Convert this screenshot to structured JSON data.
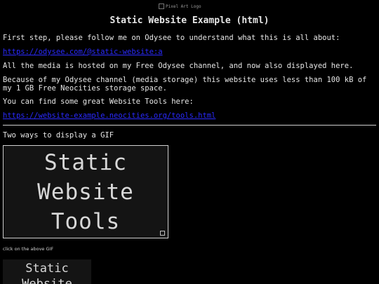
{
  "header_image": {
    "alt": "Pixel Art Logo"
  },
  "title": "Static Website Example (html)",
  "intro": "First step, please follow me on Odysee to understand what this is all about:",
  "odysee_link": "https://odysee.com/@static-website:a",
  "hosting_text": "All the media is hosted on my Free Odysee channel, and now also displayed here.",
  "storage_text": "Because of my Odysee channel (media storage) this website uses less than 100 kB of my 1 GB Free Neocities storage space.",
  "tools_text": "You can find some great Website Tools here:",
  "tools_link": "https://website-example.neocities.org/tools.html",
  "gif_heading": "Two ways to display a GIF",
  "gif1": {
    "lines": [
      "Static",
      "Website",
      "Tools"
    ]
  },
  "gif_caption": "click on the above GIF",
  "gif2": {
    "lines": [
      "Static",
      "Website"
    ]
  }
}
